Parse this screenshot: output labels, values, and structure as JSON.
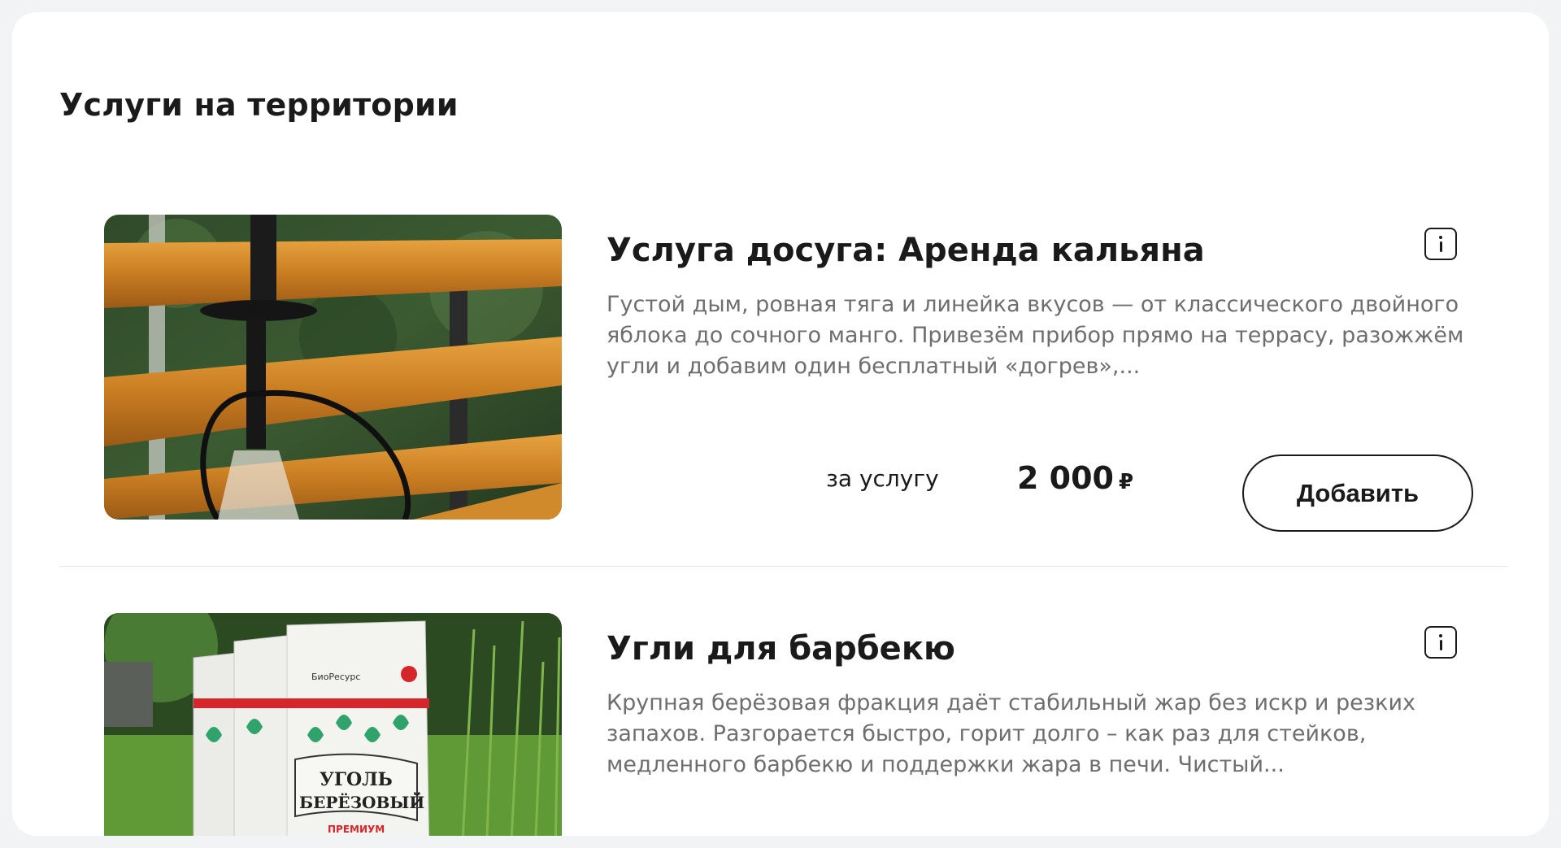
{
  "section": {
    "title": "Услуги на территории"
  },
  "services": [
    {
      "title": "Услуга досуга: Аренда кальяна",
      "description": "Густой дым, ровная тяга и линейка вкусов — от классического двойного яблока до сочного манго. Привезём прибор прямо на террасу, разожжём угли и добавим один бесплатный «догрев»,...",
      "unit": "за услугу",
      "price": "2 000",
      "currency": "₽",
      "add_label": "Добавить",
      "info_icon": "info-icon",
      "image": "hookah-photo"
    },
    {
      "title": "Угли для барбекю",
      "description": "Крупная берёзовая фракция даёт стабильный жар без искр и резких запахов. Разгорается быстро, горит долго – как раз для стейков, медленного барбекю и поддержки жара в печи. Чистый...",
      "info_icon": "info-icon",
      "image": "charcoal-bags-photo",
      "bag": {
        "brand": "БиоРесурс",
        "line1": "УГОЛЬ",
        "line2": "БЕРЁЗОВЫЙ",
        "grade": "ПРЕМИУМ"
      }
    }
  ],
  "colors": {
    "accent_text": "#1a1a1a",
    "muted_text": "#6e6e6e",
    "background": "#f1f3f5"
  }
}
